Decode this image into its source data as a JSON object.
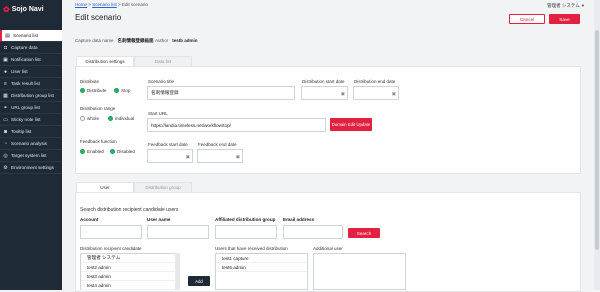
{
  "app": {
    "logo_text": "Sojo Navi"
  },
  "sidebar": {
    "items": [
      {
        "label": "Scenario list",
        "icon": "document-icon",
        "active": true
      },
      {
        "label": "Capture data",
        "icon": "camera-icon"
      },
      {
        "label": "Notification list",
        "icon": "bell-icon"
      },
      {
        "label": "User list",
        "icon": "user-icon"
      },
      {
        "label": "Task result list",
        "icon": "task-icon"
      },
      {
        "label": "Distribution group list",
        "icon": "group-icon"
      },
      {
        "label": "URL group list",
        "icon": "link-icon"
      },
      {
        "label": "Sticky note list",
        "icon": "note-icon"
      },
      {
        "label": "Tooltip list",
        "icon": "tooltip-icon"
      },
      {
        "label": "Scenario analysis",
        "icon": "chart-icon"
      },
      {
        "label": "Target system list",
        "icon": "target-icon"
      },
      {
        "label": "Environment settings",
        "icon": "gear-icon"
      }
    ]
  },
  "breadcrumb": {
    "home": "Home",
    "sep1": ">",
    "list": "Scenario list",
    "sep2": ">",
    "current": "Edit scenario"
  },
  "header": {
    "title": "Edit scenario",
    "user_name": "管理者 システム",
    "cancel_label": "Cancel",
    "save_label": "Save"
  },
  "meta": {
    "capture_label": "Capture data name",
    "capture_value": "名刺情報登録画面",
    "author_label": "Author",
    "author_value": "testb admin"
  },
  "tabs_top": {
    "settings": "Distribution settings",
    "data": "Data list"
  },
  "distribution": {
    "label": "Distribute",
    "opt_distribute": "Distribute",
    "opt_stop": "Stop",
    "range_label": "Distribution range",
    "opt_whole": "whole",
    "opt_individual": "individual",
    "feedback_label": "Feedback function",
    "opt_enabled": "Enabled",
    "opt_disabled": "Disabled"
  },
  "scenario": {
    "title_label": "Scenario title",
    "title_value": "名刺情報登録",
    "start_label": "Distribution start date",
    "end_label": "Distribution end date",
    "url_label": "Start URL",
    "url_value": "https://landia.timeless.net/workflow/top/",
    "domain_button": "Domain Edit Update",
    "fb_start_label": "Feedback start date",
    "fb_end_label": "Feedback end date"
  },
  "tabs_bottom": {
    "user": "User",
    "group": "Distribution group"
  },
  "search": {
    "section_title": "Search distribution recipient candidate users",
    "account_label": "Account",
    "username_label": "User name",
    "affiliated_label": "Affiliated distribution group",
    "email_label": "Email address",
    "search_button": "Search"
  },
  "lists": {
    "candidate_label": "Distribution recipient candidate",
    "candidates": [
      "管理者 システム",
      "test2 admin",
      "test3 admin",
      "test4 admin"
    ],
    "received_label": "Users that have received distribution",
    "received": [
      "test1 capture",
      "test6 admin"
    ],
    "additional_label": "Additional user",
    "add_button": "Add"
  }
}
